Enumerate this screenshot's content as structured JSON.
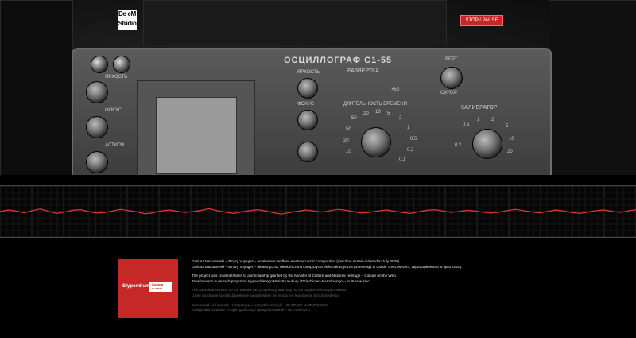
{
  "header": {
    "logo_line1": "De eM",
    "logo_line2": "Studio",
    "stop_button": "STOP / PAUSE"
  },
  "hero": {
    "device_title": "ОСЦИЛЛОГРАФ С1-55",
    "section_sweep": "РАЗВЕРТКА",
    "section_calibrator": "КАЛИБРАТОР",
    "sweep_duration_label": "ДЛИТЕЛЬНОСТЬ ВРЕМЕНИ",
    "sweep_multiplier": "×50",
    "brightness_label": "ЯРКОСТЬ",
    "focus_label": "ФОКУС",
    "astig_label": "АСТИГМ",
    "brightness_label_2": "ЯРКОСТЬ",
    "focus_label_2": "ФОКУС",
    "dial_marks": [
      "50",
      "20",
      "10",
      "5",
      "2",
      "1",
      "0.5",
      "0.2",
      "0.1",
      "50",
      "20",
      "10"
    ],
    "vert_label": "ВЕРТ",
    "sync_label": "СИНХР",
    "cal_marks": [
      "0.5",
      "1",
      "2",
      "5",
      "10",
      "20",
      "0.2"
    ]
  },
  "waveform": {
    "line_color": "#e53935",
    "samples": [
      0.0,
      0.05,
      0.02,
      -0.04,
      0.03,
      0.08,
      0.01,
      -0.06,
      -0.02,
      0.04,
      0.06,
      0.0,
      -0.05,
      -0.03,
      0.02,
      0.07,
      0.03,
      -0.01,
      -0.07,
      -0.04,
      0.02,
      0.05,
      0.01,
      -0.03,
      0.0,
      0.04,
      0.09,
      0.03,
      -0.02,
      -0.06,
      -0.01,
      0.03,
      0.06,
      0.02,
      -0.04,
      -0.08,
      -0.03,
      0.01,
      0.05,
      0.02,
      -0.02,
      0.03,
      0.07,
      0.04,
      -0.01,
      -0.05,
      -0.02,
      0.02,
      0.05,
      0.01,
      -0.03,
      -0.06,
      -0.01,
      0.04,
      0.06,
      0.02,
      -0.03,
      0.0,
      0.04,
      0.02,
      -0.02,
      -0.05,
      -0.02,
      0.03,
      0.07,
      0.03,
      -0.01,
      -0.04,
      0.0,
      0.05,
      0.02,
      -0.03,
      -0.06,
      -0.02,
      0.03,
      0.05,
      0.01,
      -0.03,
      0.02,
      0.06
    ]
  },
  "scholarship": {
    "card_title": "Stypendium",
    "badge_line1": "Kultura",
    "badge_line2": "w sieci"
  },
  "info": {
    "line1": "Dariusz Mazurowski – Binary Voyager – an aleatoric endless electroacoustic composition (real time stream initiated in July 2020).",
    "line2": "Dariusz Mazurowski – Binary Voyager – aleatoryczna, nieskończona kompozycja elektroakustyczna (transmisja w czasie rzeczywistym, zapoczątkowana w lipcu 2020).",
    "line3": "The project was created thanks to a scholarship granted by the Minister of Culture and National Heritage – Culture on the Web.",
    "line4": "Zrealizowano w ramach programu stypendialnego Ministra Kultury i Dziedzictwa Narodowego – Kultura w sieci.",
    "line5": "The soundtracks used on the website are proprietary and may not be copied without permission.",
    "line6": "Użyte na stronie ścieżki dźwiękowe są autorskie i nie mogą być kopiowane bez zezwolenia.",
    "line7": "Composed / all sounds. Kompozycja / wszystkie dźwięki – DARIUSZ MAZUROWSKI",
    "line8": "Design and software. Projekt graficzny i oprogramowanie – ALFA BRAVO"
  }
}
